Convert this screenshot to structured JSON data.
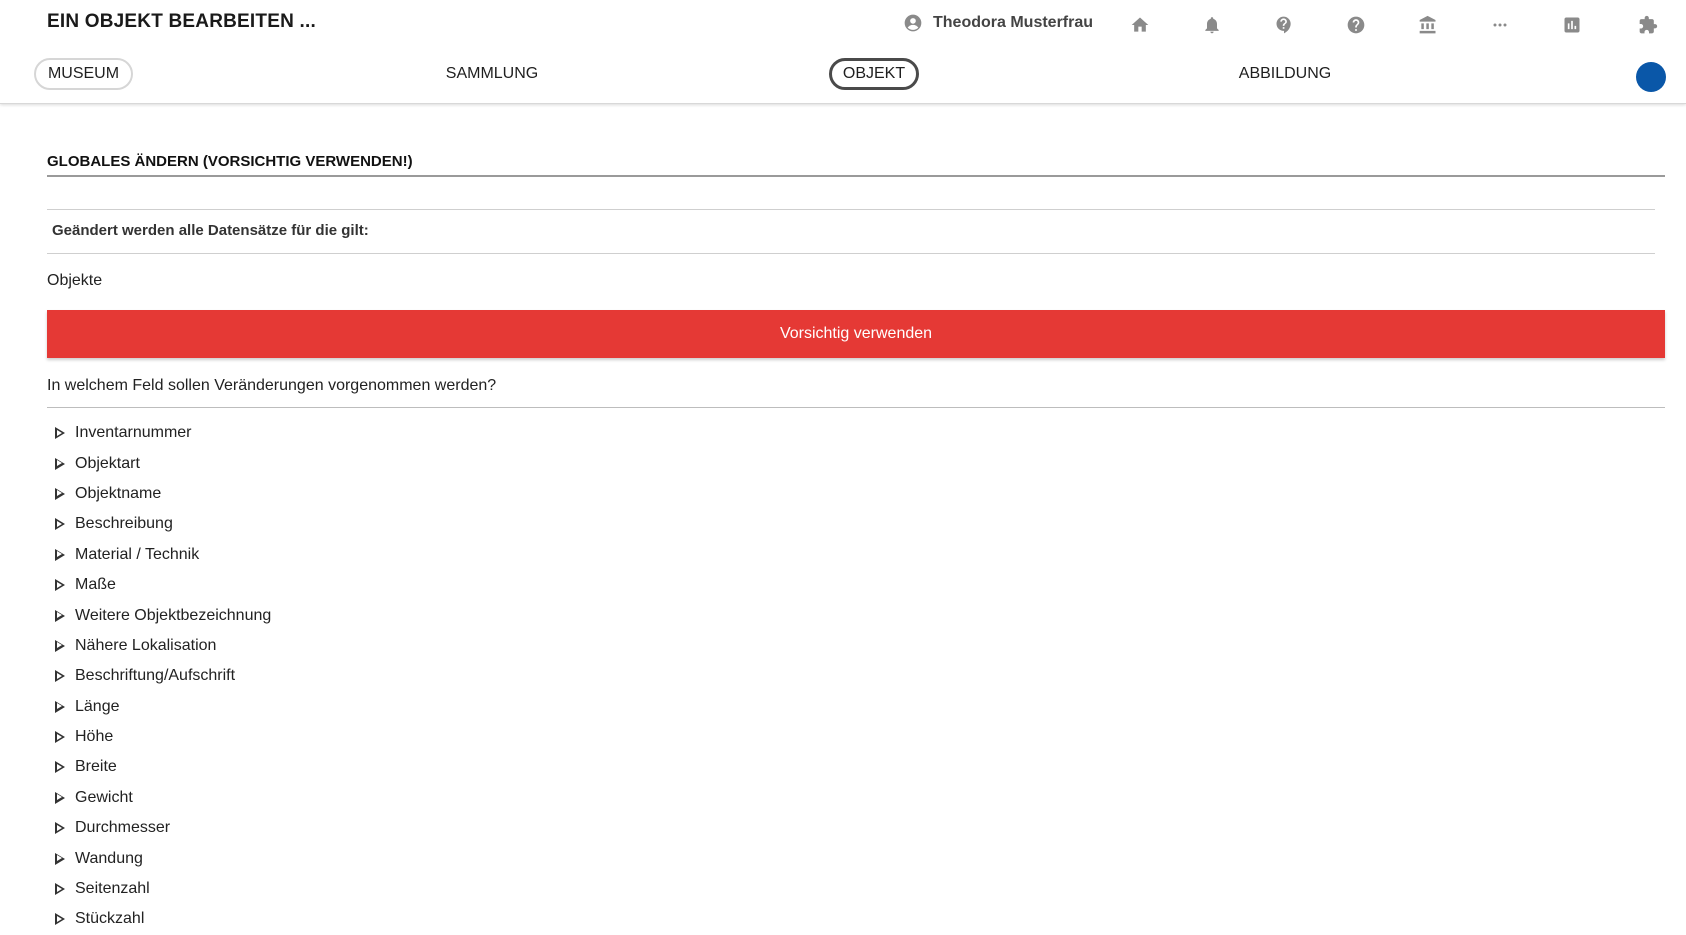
{
  "header": {
    "title": "EIN OBJEKT BEARBEITEN ...",
    "user_name": "Theodora Musterfrau",
    "icons": [
      "account-circle-icon",
      "home-icon",
      "bell-icon",
      "help-icon",
      "help-circle-icon",
      "museum-icon",
      "more-icon",
      "chart-icon",
      "puzzle-icon"
    ]
  },
  "tabs": [
    {
      "label": "MUSEUM"
    },
    {
      "label": "SAMMLUNG"
    },
    {
      "label": "OBJEKT"
    },
    {
      "label": "ABBILDUNG"
    }
  ],
  "colors": {
    "accent": "#0a57a8",
    "warning": "#e53935"
  },
  "section": {
    "title": "GLOBALES ÄNDERN (VORSICHTIG VERWENDEN!)",
    "description": "Geändert werden alle Datensätze für die gilt:",
    "scope": "Objekte",
    "warning_button": "Vorsichtig verwenden",
    "question": "In welchem Feld sollen Veränderungen vorgenommen werden?"
  },
  "fields": [
    "Inventarnummer",
    "Objektart",
    "Objektname",
    "Beschreibung",
    "Material / Technik",
    "Maße",
    "Weitere Objektbezeichnung",
    "Nähere Lokalisation",
    "Beschriftung/Aufschrift",
    "Länge",
    "Höhe",
    "Breite",
    "Gewicht",
    "Durchmesser",
    "Wandung",
    "Seitenzahl",
    "Stückzahl"
  ]
}
